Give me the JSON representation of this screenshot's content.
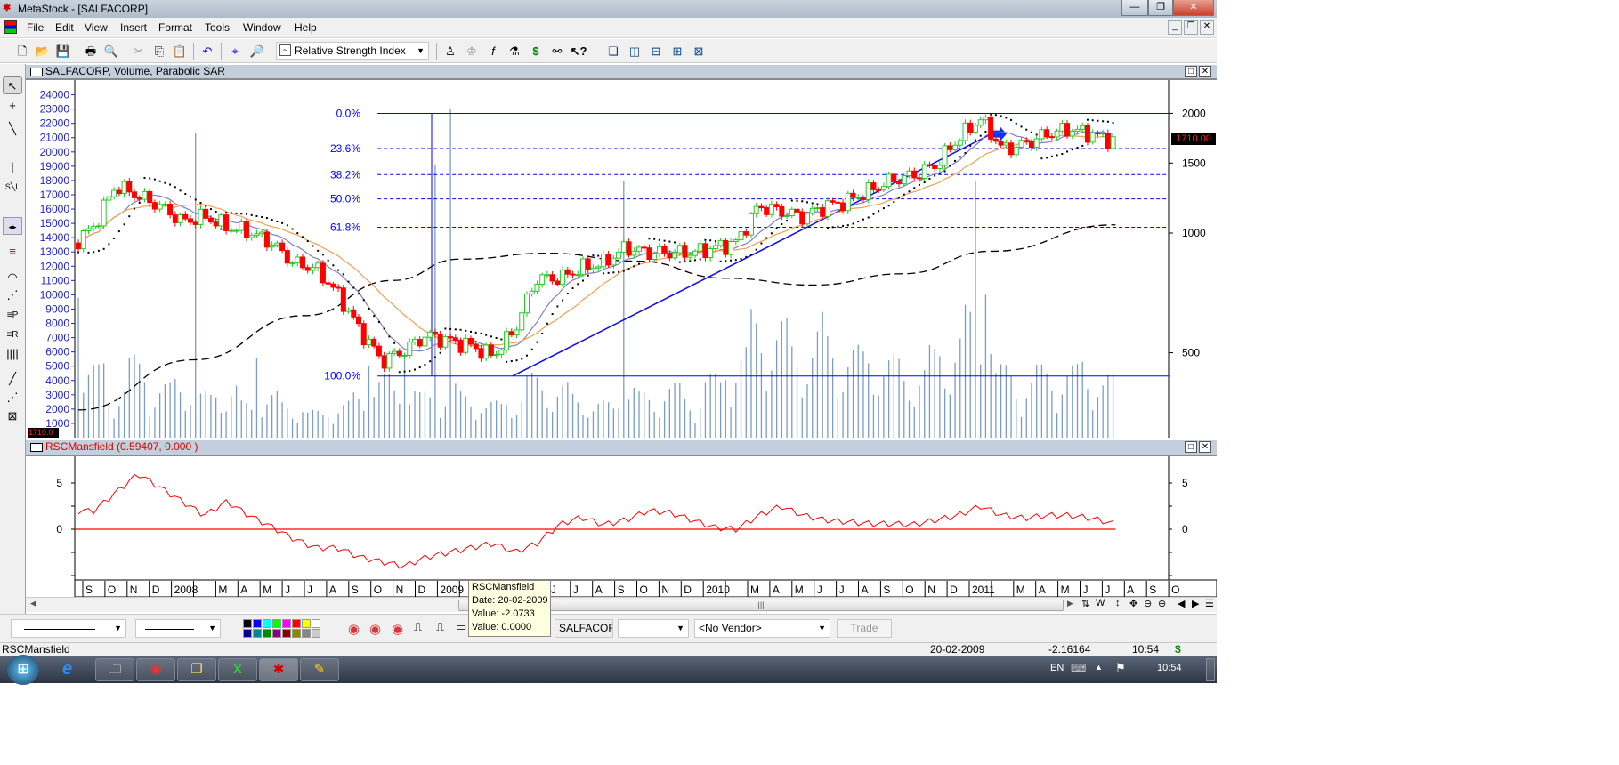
{
  "window": {
    "title": "MetaStock - [SALFACORP]",
    "min": "—",
    "max": "❐",
    "close": "✕"
  },
  "menu": [
    "File",
    "Edit",
    "View",
    "Insert",
    "Format",
    "Tools",
    "Window",
    "Help"
  ],
  "toolbar": {
    "indicator_select": "Relative Strength Index"
  },
  "price_panel": {
    "title": "SALFACORP, Volume, Parabolic SAR",
    "last_price": "1710.00",
    "left_price_box": "1710.0"
  },
  "rsc_panel": {
    "title": "RSCMansfield",
    "params": "(0.59407, 0.000 )"
  },
  "tooltip": {
    "name": "RSCMansfield",
    "date": "Date: 20-02-2009",
    "value1": "Value: -2.0733",
    "value2": "Value: 0.0000"
  },
  "bottom": {
    "symbol": "SALFACORP",
    "vendor": "<No Vendor>",
    "trade": "Trade",
    "blank_select": ""
  },
  "status": {
    "left": "RSCMansfield",
    "date": "20-02-2009",
    "value": "-2.16164",
    "time": "10:54",
    "dollar": "$"
  },
  "taskbar": {
    "lang": "EN",
    "time": "10:54"
  },
  "colors": {
    "up": "#22cc22",
    "down": "#ff0000",
    "axis_text": "#2323c8",
    "fib": "#0000ff",
    "rsc": "#ff0000",
    "volume": "#7a9cc6"
  },
  "chart_data": {
    "type": "candlestick",
    "x_unit": "months since Sep 2007",
    "month_labels": [
      "S",
      "O",
      "N",
      "D",
      "2008",
      "",
      "M",
      "A",
      "M",
      "J",
      "J",
      "A",
      "S",
      "O",
      "N",
      "D",
      "2009",
      "",
      "M",
      "A",
      "M",
      "J",
      "J",
      "A",
      "S",
      "O",
      "N",
      "D",
      "2010",
      "",
      "M",
      "A",
      "M",
      "J",
      "J",
      "A",
      "S",
      "O",
      "N",
      "D",
      "2011",
      "",
      "M",
      "A",
      "M",
      "J",
      "J",
      "A",
      "S",
      "O"
    ],
    "monthly_close": [
      1036,
      1316,
      1240,
      1168,
      1068,
      1100,
      1036,
      1006,
      947,
      841,
      816,
      703,
      570,
      476,
      506,
      553,
      537,
      521,
      490,
      570,
      769,
      769,
      816,
      841,
      919,
      893,
      893,
      893,
      919,
      947,
      1168,
      1134,
      1100,
      1168,
      1204,
      1278,
      1356,
      1398,
      1484,
      1724,
      1940,
      1623,
      1672,
      1775,
      1826,
      1775,
      1710
    ],
    "volume_base": [
      4000,
      3000,
      4500,
      3000,
      3500,
      2500,
      3000,
      2000,
      2500,
      2000,
      1500,
      2000,
      2500,
      3500,
      3000,
      2500,
      3000,
      2500,
      2000,
      2500,
      3500,
      3000,
      2500,
      2000,
      3000,
      2500,
      3000,
      2500,
      3500,
      5000,
      7000,
      6500,
      5500,
      6000,
      5000,
      5000,
      4500,
      4000,
      5000,
      6000,
      7000,
      4000,
      3500,
      4000,
      4000,
      4000,
      3500
    ],
    "volume_spikes": [
      [
        -0.1,
        9800
      ],
      [
        0.9,
        5200
      ],
      [
        2.2,
        5600
      ],
      [
        5.1,
        21300
      ],
      [
        7.9,
        5600
      ],
      [
        13.0,
        5000
      ],
      [
        14.6,
        5500
      ],
      [
        15.9,
        19100
      ],
      [
        16.5,
        23000
      ],
      [
        24.5,
        18000
      ],
      [
        30.5,
        8000
      ],
      [
        33.3,
        8800
      ],
      [
        35.4,
        5200
      ],
      [
        38.6,
        5700
      ],
      [
        39.9,
        9300
      ],
      [
        40.3,
        18000
      ],
      [
        40.7,
        10000
      ],
      [
        45.0,
        5300
      ]
    ],
    "long_ma": [
      [
        -0.2,
        359
      ],
      [
        5,
        480
      ],
      [
        10,
        620
      ],
      [
        14,
        760
      ],
      [
        17,
        860
      ],
      [
        21,
        890
      ],
      [
        25,
        850
      ],
      [
        29,
        770
      ],
      [
        33,
        740
      ],
      [
        37,
        790
      ],
      [
        41,
        900
      ],
      [
        46.6,
        1049
      ]
    ],
    "trendline": [
      [
        19.4,
        437
      ],
      [
        41.0,
        1775
      ]
    ],
    "fib": {
      "high": 2000,
      "low": 437,
      "start_month": 13.3,
      "levels": [
        {
          "pct": 0,
          "label": "0.0%"
        },
        {
          "pct": 0.236,
          "label": "23.6%"
        },
        {
          "pct": 0.382,
          "label": "38.2%"
        },
        {
          "pct": 0.5,
          "label": "50.0%"
        },
        {
          "pct": 0.618,
          "label": "61.8%"
        },
        {
          "pct": 1,
          "label": "100.0%"
        }
      ]
    },
    "left_axis_ticks": [
      1000,
      2000,
      3000,
      4000,
      5000,
      6000,
      7000,
      8000,
      9000,
      10000,
      11000,
      12000,
      13000,
      14000,
      15000,
      16000,
      17000,
      18000,
      19000,
      20000,
      21000,
      22000,
      23000,
      24000
    ],
    "right_axis_ticks": [
      500,
      1000,
      1500,
      2000
    ],
    "rsc_monthly": [
      2,
      4,
      6,
      4.5,
      3,
      1.5,
      3,
      1.5,
      0.3,
      -1,
      -2,
      -2,
      -3,
      -3.5,
      -4,
      -3,
      -2.5,
      -2,
      -1.5,
      -2.5,
      -1.5,
      0.5,
      1.3,
      0.5,
      1,
      2,
      1.8,
      1,
      0.2,
      0,
      1.5,
      2.5,
      1.5,
      1,
      0.8,
      0.6,
      0.6,
      0.5,
      1,
      1.5,
      2.5,
      1.5,
      1.2,
      1.5,
      1.5,
      1.2,
      0.6
    ],
    "rsc_axis_ticks": [
      5,
      0
    ]
  }
}
